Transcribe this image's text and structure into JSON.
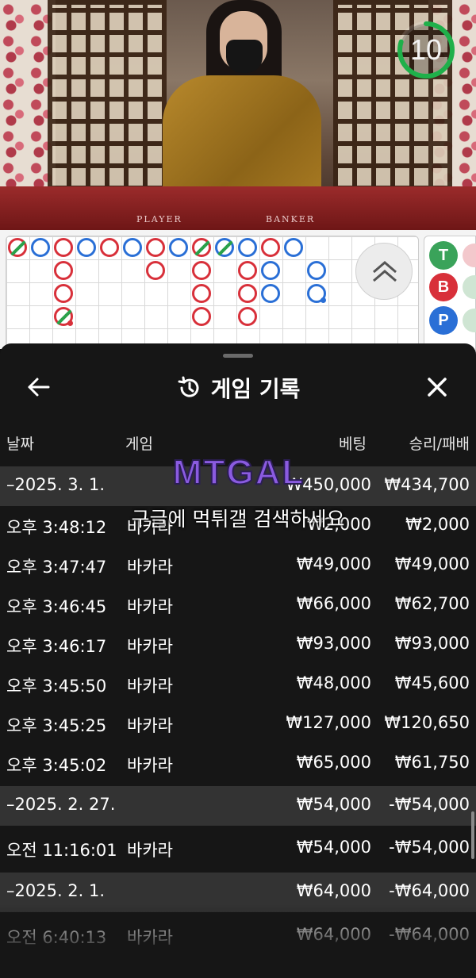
{
  "video": {
    "table_labels": {
      "player": "PLAYER",
      "banker": "BANKER"
    },
    "timer": {
      "value": "10",
      "fraction_remaining": 0.8,
      "color": "#1fb04a"
    }
  },
  "roadmap": {
    "side_labels": {
      "tie": "T",
      "banker": "B",
      "player": "P"
    },
    "colors": {
      "banker": "#d8303a",
      "player": "#2a6fd6",
      "tie": "#2aa14a"
    }
  },
  "sheet": {
    "title": "게임 기록",
    "columns": {
      "date": "날짜",
      "game": "게임",
      "bet": "베팅",
      "result": "승리/패배"
    },
    "rows": [
      {
        "type": "date",
        "date": "–2025. 3. 1.",
        "game": "",
        "bet": "₩450,000",
        "result": "₩434,700"
      },
      {
        "type": "entry",
        "date": "오후 3:48:12",
        "game": "바카라",
        "bet": "₩2,000",
        "result": "₩2,000"
      },
      {
        "type": "entry",
        "date": "오후 3:47:47",
        "game": "바카라",
        "bet": "₩49,000",
        "result": "₩49,000"
      },
      {
        "type": "entry",
        "date": "오후 3:46:45",
        "game": "바카라",
        "bet": "₩66,000",
        "result": "₩62,700"
      },
      {
        "type": "entry",
        "date": "오후 3:46:17",
        "game": "바카라",
        "bet": "₩93,000",
        "result": "₩93,000"
      },
      {
        "type": "entry",
        "date": "오후 3:45:50",
        "game": "바카라",
        "bet": "₩48,000",
        "result": "₩45,600"
      },
      {
        "type": "entry",
        "date": "오후 3:45:25",
        "game": "바카라",
        "bet": "₩127,000",
        "result": "₩120,650"
      },
      {
        "type": "entry",
        "date": "오후 3:45:02",
        "game": "바카라",
        "bet": "₩65,000",
        "result": "₩61,750"
      },
      {
        "type": "date",
        "date": "–2025. 2. 27.",
        "game": "",
        "bet": "₩54,000",
        "result": "-₩54,000"
      },
      {
        "type": "entry",
        "date": "오전 11:16:01",
        "game": "바카라",
        "bet": "₩54,000",
        "result": "-₩54,000"
      },
      {
        "type": "date",
        "date": "–2025. 2. 1.",
        "game": "",
        "bet": "₩64,000",
        "result": "-₩64,000"
      },
      {
        "type": "entry",
        "date": "오전 6:40:13",
        "game": "바카라",
        "bet": "₩64,000",
        "result": "-₩64,000"
      }
    ]
  },
  "watermark": {
    "logo": "MTGAL",
    "text": "구글에 먹튀갤 검색하세요"
  }
}
